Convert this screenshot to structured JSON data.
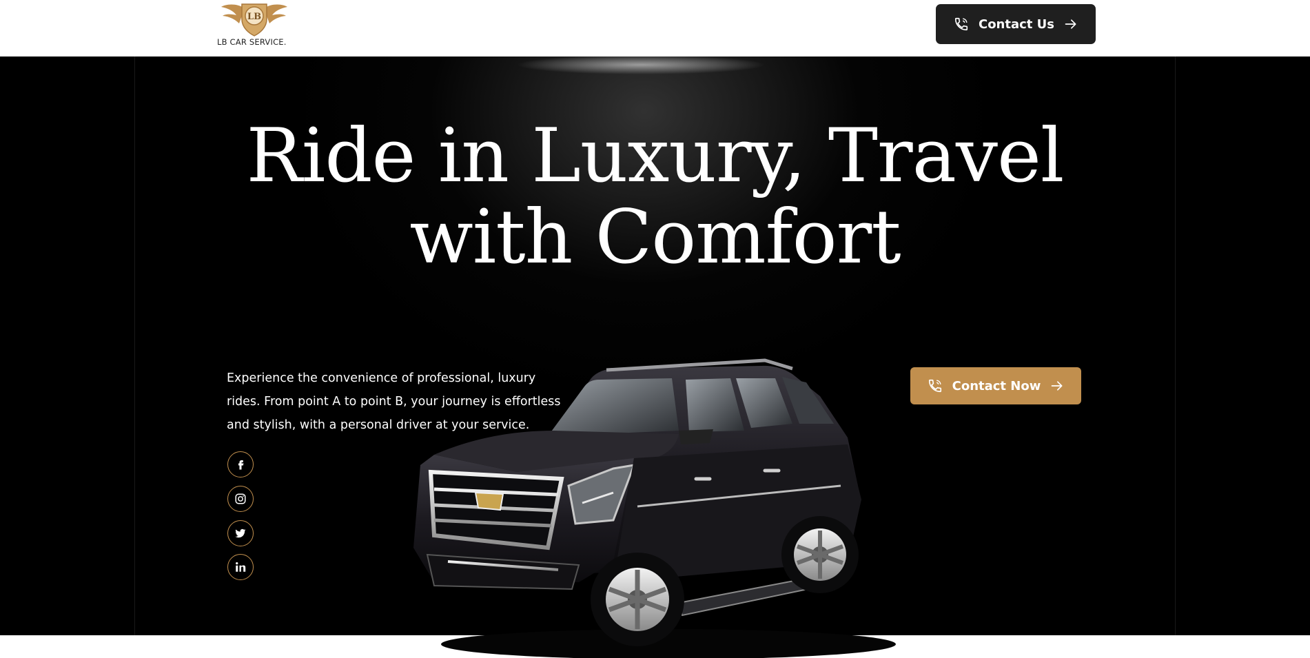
{
  "brand": {
    "monogram": "LB",
    "wordmark": "LB CAR SERVICE.",
    "gold": "#c18f4e"
  },
  "header": {
    "contact_label": "Contact Us",
    "phone_icon": "phone-icon",
    "arrow_icon": "arrow-right-icon"
  },
  "hero": {
    "title_line1": "Ride in Luxury, Travel",
    "title_line2": "with Comfort",
    "description": "Experience the convenience of professional, luxury rides. From point A to point B, your journey is effortless and stylish, with a personal driver at your service.",
    "cta_label": "Contact Now",
    "social": [
      "facebook-icon",
      "instagram-icon",
      "twitter-icon",
      "linkedin-icon"
    ]
  },
  "colors": {
    "hero_bg": "#000000",
    "dark_button": "#1f1f1f",
    "accent": "#c18f4e"
  }
}
